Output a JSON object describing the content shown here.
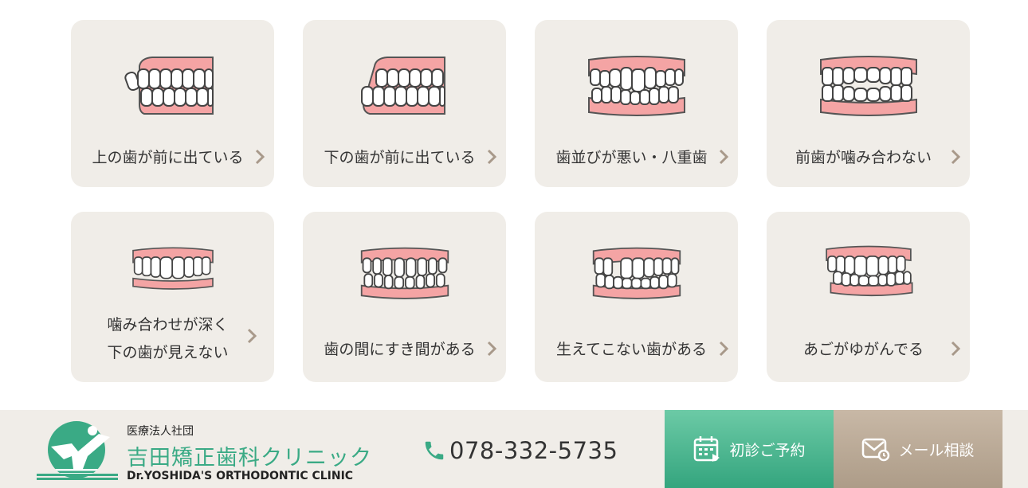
{
  "cards": [
    {
      "label": "上の歯が前に出ている",
      "icon": "upper-protrusion-teeth-icon"
    },
    {
      "label": "下の歯が前に出ている",
      "icon": "underbite-teeth-icon"
    },
    {
      "label": "歯並びが悪い・八重歯",
      "icon": "crowded-teeth-icon"
    },
    {
      "label": "前歯が噛み合わない",
      "icon": "open-bite-teeth-icon"
    },
    {
      "label_line1": "噛み合わせが深く",
      "label_line2": "下の歯が見えない",
      "icon": "deep-bite-teeth-icon"
    },
    {
      "label": "歯の間にすき間がある",
      "icon": "gapped-teeth-icon"
    },
    {
      "label": "生えてこない歯がある",
      "icon": "missing-teeth-icon"
    },
    {
      "label": "あごがゆがんでる",
      "icon": "crossbite-teeth-icon"
    }
  ],
  "footer": {
    "corp": "医療法人社団",
    "clinic_name": "吉田矯正歯科クリニック",
    "clinic_en": "Dr.YOSHIDA'S ORTHODONTIC CLINIC",
    "phone": "078-332-5735",
    "reserve_label": "初診ご予約",
    "mail_label": "メール相談"
  },
  "colors": {
    "card_bg": "#f0ede8",
    "gum": "#f4a4a4",
    "accent_green": "#3aaa85",
    "chevron": "#a8998a",
    "mail_bg": "#b8a794"
  }
}
